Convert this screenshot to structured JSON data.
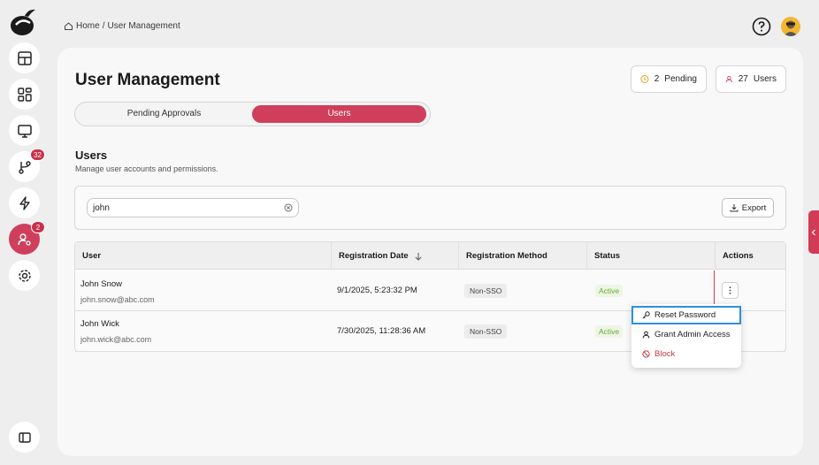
{
  "breadcrumb": {
    "home": "Home",
    "separator": "/",
    "current": "User Management"
  },
  "sidebar": {
    "items": [
      {
        "name": "dashboard-icon",
        "badge": ""
      },
      {
        "name": "apps-grid-icon",
        "badge": ""
      },
      {
        "name": "monitor-icon",
        "badge": ""
      },
      {
        "name": "branch-icon",
        "badge": "32"
      },
      {
        "name": "lightning-icon",
        "badge": ""
      },
      {
        "name": "user-settings-icon",
        "badge": "2"
      },
      {
        "name": "gear-icon",
        "badge": ""
      }
    ],
    "collapse_icon": "sidebar-collapse-icon"
  },
  "header": {
    "title": "User Management",
    "pending_count": "2",
    "pending_label": "Pending",
    "users_count": "27",
    "users_label": "Users"
  },
  "tabs": [
    {
      "label": "Pending Approvals",
      "active": false
    },
    {
      "label": "Users",
      "active": true
    }
  ],
  "section": {
    "title": "Users",
    "subtitle": "Manage user accounts and permissions."
  },
  "search": {
    "value": "john",
    "placeholder": ""
  },
  "export_label": "Export",
  "table": {
    "columns": [
      "User",
      "Registration Date",
      "Registration Method",
      "Status",
      "Actions"
    ],
    "rows": [
      {
        "name": "John Snow",
        "email": "john.snow@abc.com",
        "date": "9/1/2025, 5:23:32 PM",
        "method": "Non-SSO",
        "status": "Active"
      },
      {
        "name": "John Wick",
        "email": "john.wick@abc.com",
        "date": "7/30/2025, 11:28:36 AM",
        "method": "Non-SSO",
        "status": "Active"
      }
    ]
  },
  "actions_menu": {
    "items": [
      {
        "label": "Reset Password",
        "icon": "key-icon"
      },
      {
        "label": "Grant Admin Access",
        "icon": "user-icon"
      },
      {
        "label": "Block",
        "icon": "block-icon"
      }
    ]
  },
  "colors": {
    "accent": "#cf3f5b",
    "status_active": "#5fb12e",
    "focus": "#2f8ee0"
  }
}
